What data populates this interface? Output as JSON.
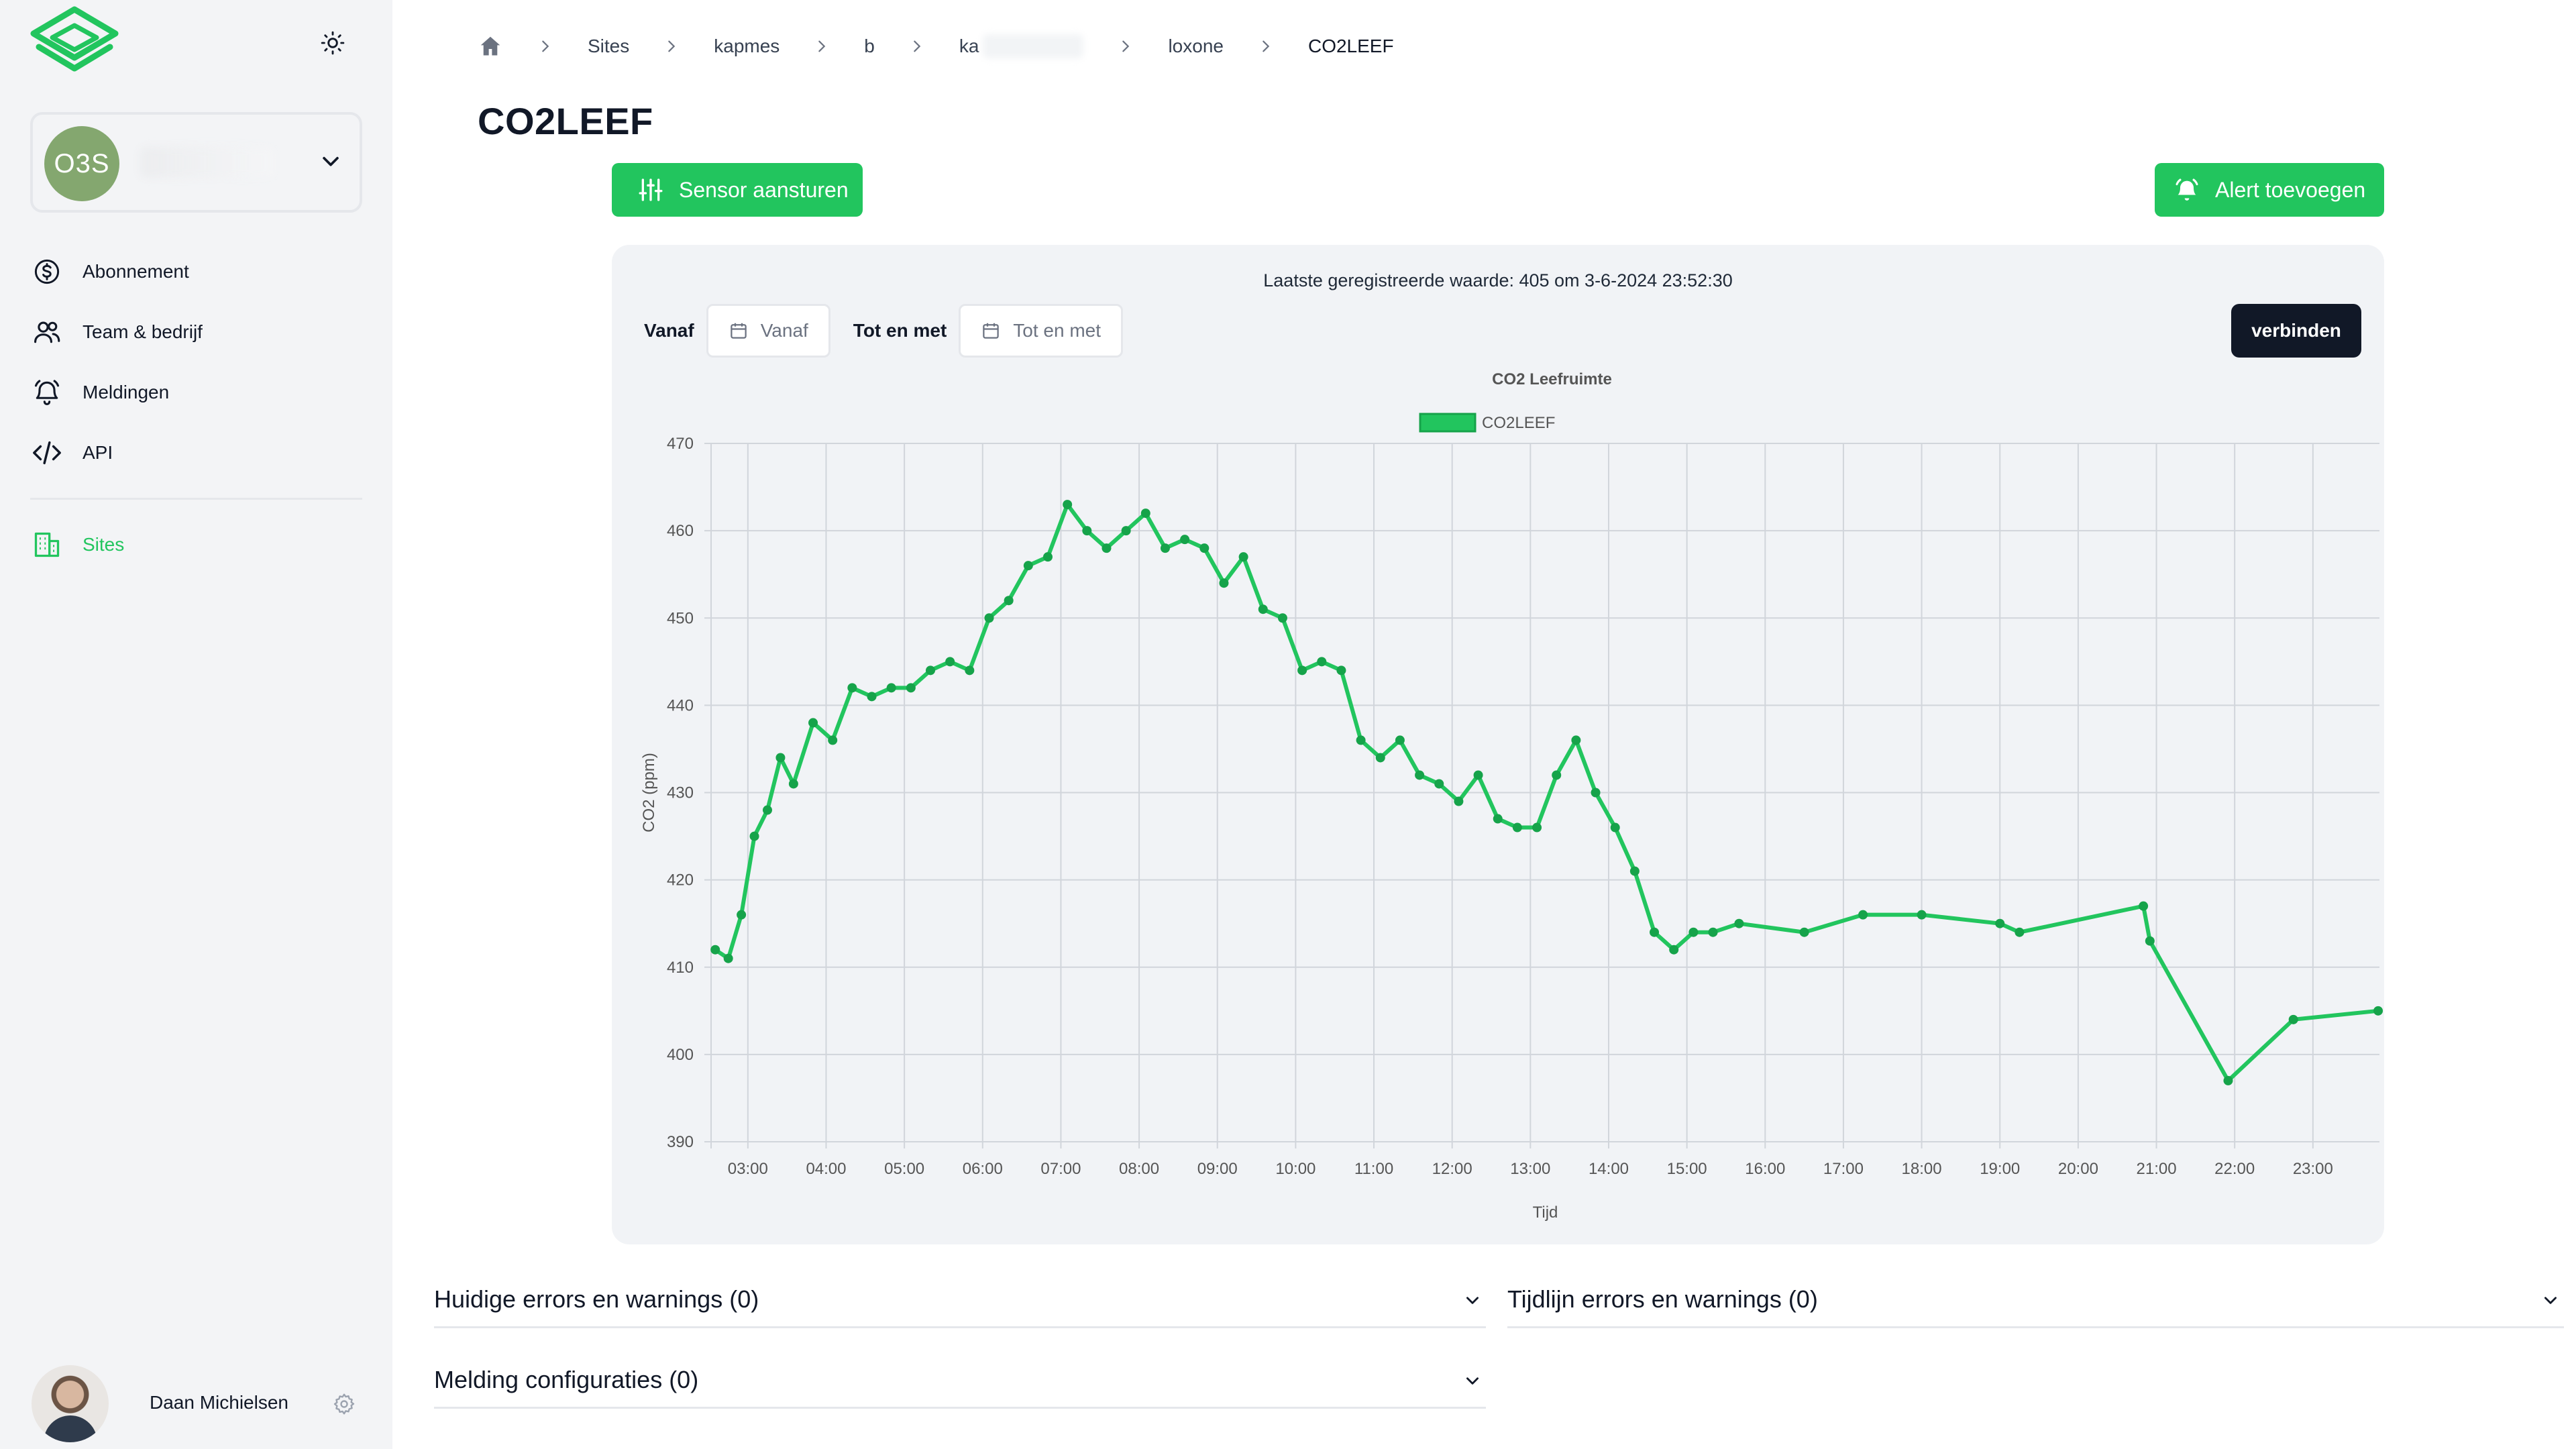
{
  "sidebar": {
    "org": {
      "initials": "O3S"
    },
    "nav": [
      {
        "label": "Abonnement",
        "icon": "dollar-circle-icon"
      },
      {
        "label": "Team & bedrijf",
        "icon": "users-icon"
      },
      {
        "label": "Meldingen",
        "icon": "bell-icon"
      },
      {
        "label": "API",
        "icon": "code-icon"
      }
    ],
    "sites": {
      "label": "Sites",
      "icon": "building-icon",
      "active": true
    },
    "user": {
      "name": "Daan Michielsen"
    }
  },
  "breadcrumb": [
    {
      "label": "Sites"
    },
    {
      "label": "kapmes"
    },
    {
      "label": "b"
    },
    {
      "label": "ka"
    },
    {
      "label": "loxone"
    },
    {
      "label": "CO2LEEF"
    }
  ],
  "page": {
    "title": "CO2LEEF",
    "sensor_button": "Sensor aansturen",
    "alert_button": "Alert toevoegen"
  },
  "panel": {
    "last_value": "Laatste geregistreerde waarde: 405 om 3-6-2024 23:52:30",
    "from_label": "Vanaf",
    "from_placeholder": "Vanaf",
    "to_label": "Tot en met",
    "to_placeholder": "Tot en met",
    "connect_button": "verbinden"
  },
  "colors": {
    "accent": "#22c55e",
    "dark": "#111827",
    "panel_bg": "#f1f3f6",
    "grid": "#d1d5db"
  },
  "chart_data": {
    "type": "line",
    "title": "CO2 Leefruimte",
    "xlabel": "Tijd",
    "ylabel": "CO2 (ppm)",
    "ylim": [
      390,
      470
    ],
    "yticks": [
      390,
      400,
      410,
      420,
      430,
      440,
      450,
      460,
      470
    ],
    "xticks": [
      "03:00",
      "04:00",
      "05:00",
      "06:00",
      "07:00",
      "08:00",
      "09:00",
      "10:00",
      "11:00",
      "12:00",
      "13:00",
      "14:00",
      "15:00",
      "16:00",
      "17:00",
      "18:00",
      "19:00",
      "20:00",
      "21:00",
      "22:00",
      "23:00"
    ],
    "xlim_hours": [
      2.53,
      23.85
    ],
    "legend_position": "top-center",
    "grid": true,
    "series": [
      {
        "name": "CO2LEEF",
        "color": "#22c55e",
        "points": [
          [
            "02:35",
            412
          ],
          [
            "02:45",
            411
          ],
          [
            "02:55",
            416
          ],
          [
            "03:05",
            425
          ],
          [
            "03:15",
            428
          ],
          [
            "03:25",
            434
          ],
          [
            "03:35",
            431
          ],
          [
            "03:50",
            438
          ],
          [
            "04:05",
            436
          ],
          [
            "04:20",
            442
          ],
          [
            "04:35",
            441
          ],
          [
            "04:50",
            442
          ],
          [
            "05:05",
            442
          ],
          [
            "05:20",
            444
          ],
          [
            "05:35",
            445
          ],
          [
            "05:50",
            444
          ],
          [
            "06:05",
            450
          ],
          [
            "06:20",
            452
          ],
          [
            "06:35",
            456
          ],
          [
            "06:50",
            457
          ],
          [
            "07:05",
            463
          ],
          [
            "07:20",
            460
          ],
          [
            "07:35",
            458
          ],
          [
            "07:50",
            460
          ],
          [
            "08:05",
            462
          ],
          [
            "08:20",
            458
          ],
          [
            "08:35",
            459
          ],
          [
            "08:50",
            458
          ],
          [
            "09:05",
            454
          ],
          [
            "09:20",
            457
          ],
          [
            "09:35",
            451
          ],
          [
            "09:50",
            450
          ],
          [
            "10:05",
            444
          ],
          [
            "10:20",
            445
          ],
          [
            "10:35",
            444
          ],
          [
            "10:50",
            436
          ],
          [
            "11:05",
            434
          ],
          [
            "11:20",
            436
          ],
          [
            "11:35",
            432
          ],
          [
            "11:50",
            431
          ],
          [
            "12:05",
            429
          ],
          [
            "12:20",
            432
          ],
          [
            "12:35",
            427
          ],
          [
            "12:50",
            426
          ],
          [
            "13:05",
            426
          ],
          [
            "13:20",
            432
          ],
          [
            "13:35",
            436
          ],
          [
            "13:50",
            430
          ],
          [
            "14:05",
            426
          ],
          [
            "14:20",
            421
          ],
          [
            "14:35",
            414
          ],
          [
            "14:50",
            412
          ],
          [
            "15:05",
            414
          ],
          [
            "15:20",
            414
          ],
          [
            "15:40",
            415
          ],
          [
            "16:30",
            414
          ],
          [
            "17:15",
            416
          ],
          [
            "18:00",
            416
          ],
          [
            "19:00",
            415
          ],
          [
            "19:15",
            414
          ],
          [
            "20:50",
            417
          ],
          [
            "20:55",
            413
          ],
          [
            "21:55",
            397
          ],
          [
            "22:45",
            404
          ],
          [
            "23:50",
            405
          ]
        ]
      }
    ]
  },
  "accordions": [
    {
      "title": "Huidige errors en warnings (0)"
    },
    {
      "title": "Tijdlijn errors en warnings (0)"
    },
    {
      "title": "Melding configuraties (0)"
    }
  ]
}
